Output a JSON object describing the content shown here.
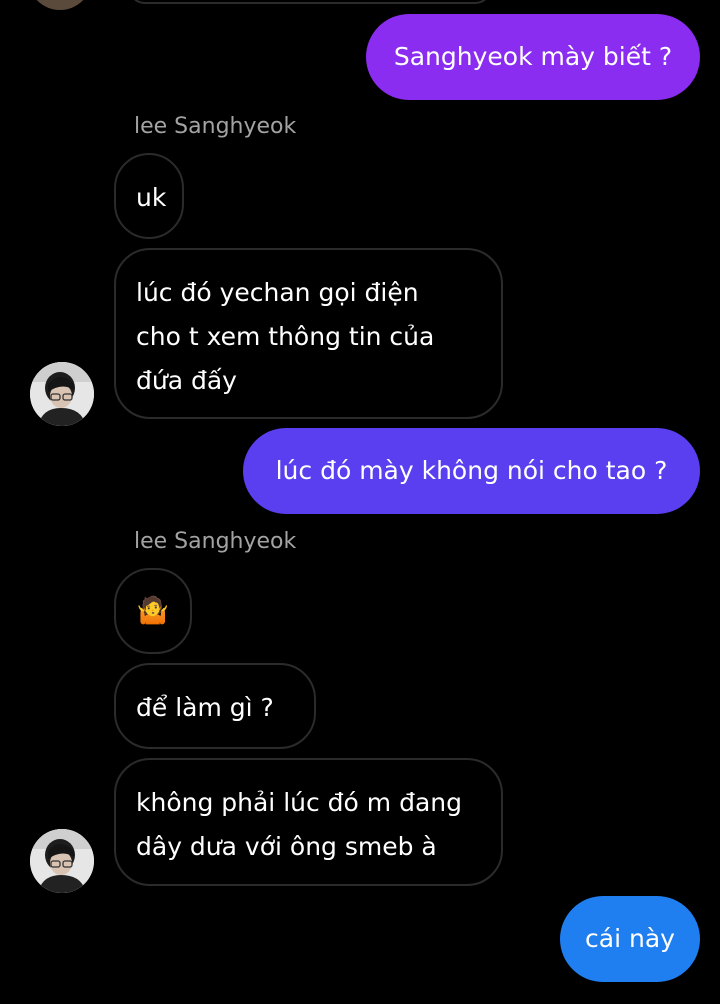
{
  "colors": {
    "background": "#000000",
    "outgoing_purple": "#8a2df0",
    "outgoing_indigo": "#5a3ff0",
    "outgoing_blue": "#1f7ef0",
    "incoming_border": "#2b2b2b",
    "sender_name": "#a3a3a3"
  },
  "chat": {
    "messages": [
      {
        "id": "m1",
        "direction": "outgoing",
        "text": "Sanghyeok mày biết ?"
      },
      {
        "id": "m2",
        "direction": "incoming",
        "sender": "lee Sanghyeok",
        "text": "uk"
      },
      {
        "id": "m3",
        "direction": "incoming",
        "lines": [
          "lúc đó yechan gọi điện",
          "cho t xem thông tin của",
          "đứa đấy"
        ]
      },
      {
        "id": "m4",
        "direction": "outgoing",
        "text": "lúc đó mày không nói cho tao ?"
      },
      {
        "id": "m5",
        "direction": "incoming",
        "sender": "lee Sanghyeok",
        "text": "🤷",
        "icon": "person-shrugging-icon"
      },
      {
        "id": "m6",
        "direction": "incoming",
        "text": "để làm gì ?"
      },
      {
        "id": "m7",
        "direction": "incoming",
        "lines": [
          "không phải lúc đó m đang",
          "dây dưa với ông smeb à"
        ]
      },
      {
        "id": "m8",
        "direction": "outgoing",
        "text": "cái này"
      }
    ]
  }
}
